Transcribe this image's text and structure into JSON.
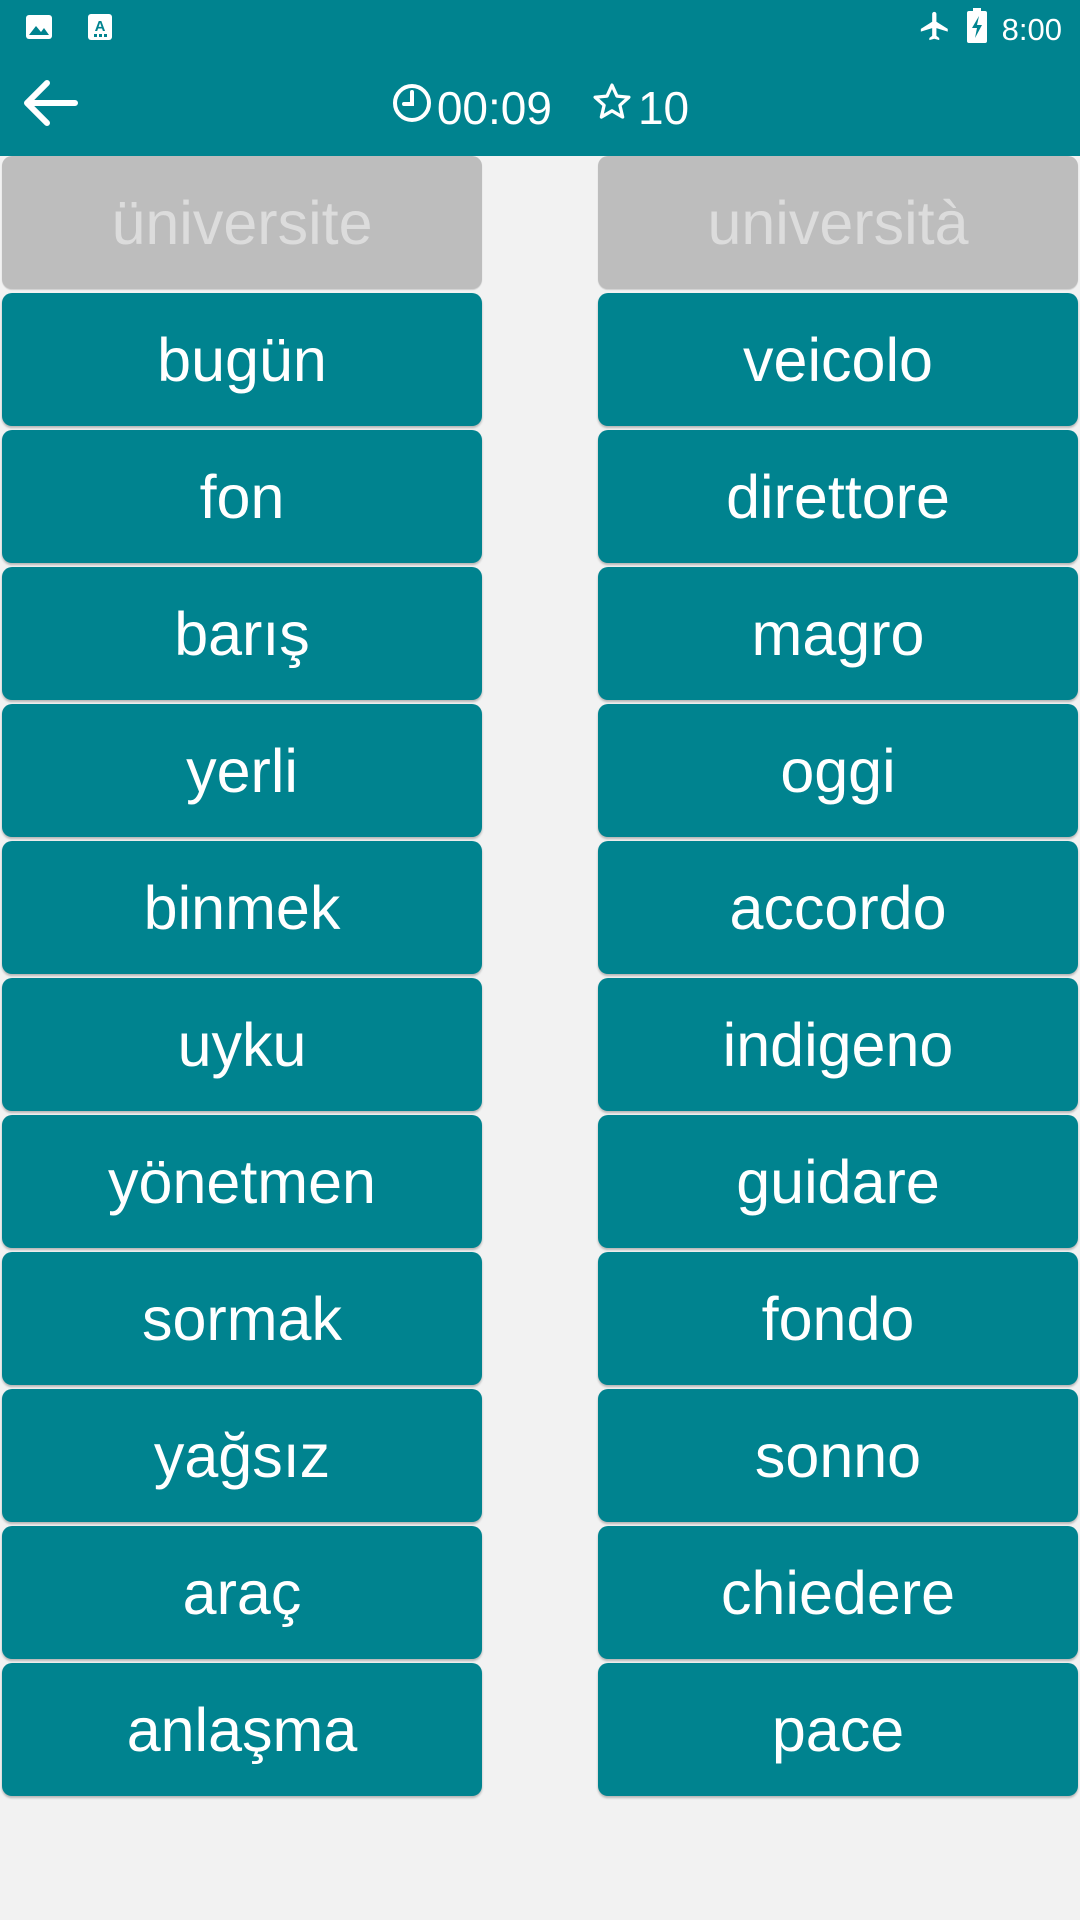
{
  "status_bar": {
    "time": "8:00",
    "left_icons": [
      "image-icon",
      "font-download-icon"
    ],
    "right_icons": [
      "airplane-mode-icon",
      "battery-charging-icon"
    ]
  },
  "header": {
    "timer": "00:09",
    "stars": "10",
    "icons": {
      "back": "arrow-left-icon",
      "timer": "clock-icon",
      "stars": "star-outline-icon"
    }
  },
  "colors": {
    "primary": "#00838f",
    "matched_tile": "#bdbdbd",
    "matched_text": "#dcdcdc",
    "background": "#f2f2f2"
  },
  "board": {
    "left": [
      {
        "label": "üniversite",
        "state": "matched"
      },
      {
        "label": "bugün",
        "state": "active"
      },
      {
        "label": "fon",
        "state": "active"
      },
      {
        "label": "barış",
        "state": "active"
      },
      {
        "label": "yerli",
        "state": "active"
      },
      {
        "label": "binmek",
        "state": "active"
      },
      {
        "label": "uyku",
        "state": "active"
      },
      {
        "label": "yönetmen",
        "state": "active"
      },
      {
        "label": "sormak",
        "state": "active"
      },
      {
        "label": "yağsız",
        "state": "active"
      },
      {
        "label": "araç",
        "state": "active"
      },
      {
        "label": "anlaşma",
        "state": "active"
      }
    ],
    "right": [
      {
        "label": "università",
        "state": "matched"
      },
      {
        "label": "veicolo",
        "state": "active"
      },
      {
        "label": "direttore",
        "state": "active"
      },
      {
        "label": "magro",
        "state": "active"
      },
      {
        "label": "oggi",
        "state": "active"
      },
      {
        "label": "accordo",
        "state": "active"
      },
      {
        "label": "indigeno",
        "state": "active"
      },
      {
        "label": "guidare",
        "state": "active"
      },
      {
        "label": "fondo",
        "state": "active"
      },
      {
        "label": "sonno",
        "state": "active"
      },
      {
        "label": "chiedere",
        "state": "active"
      },
      {
        "label": "pace",
        "state": "active"
      }
    ]
  }
}
